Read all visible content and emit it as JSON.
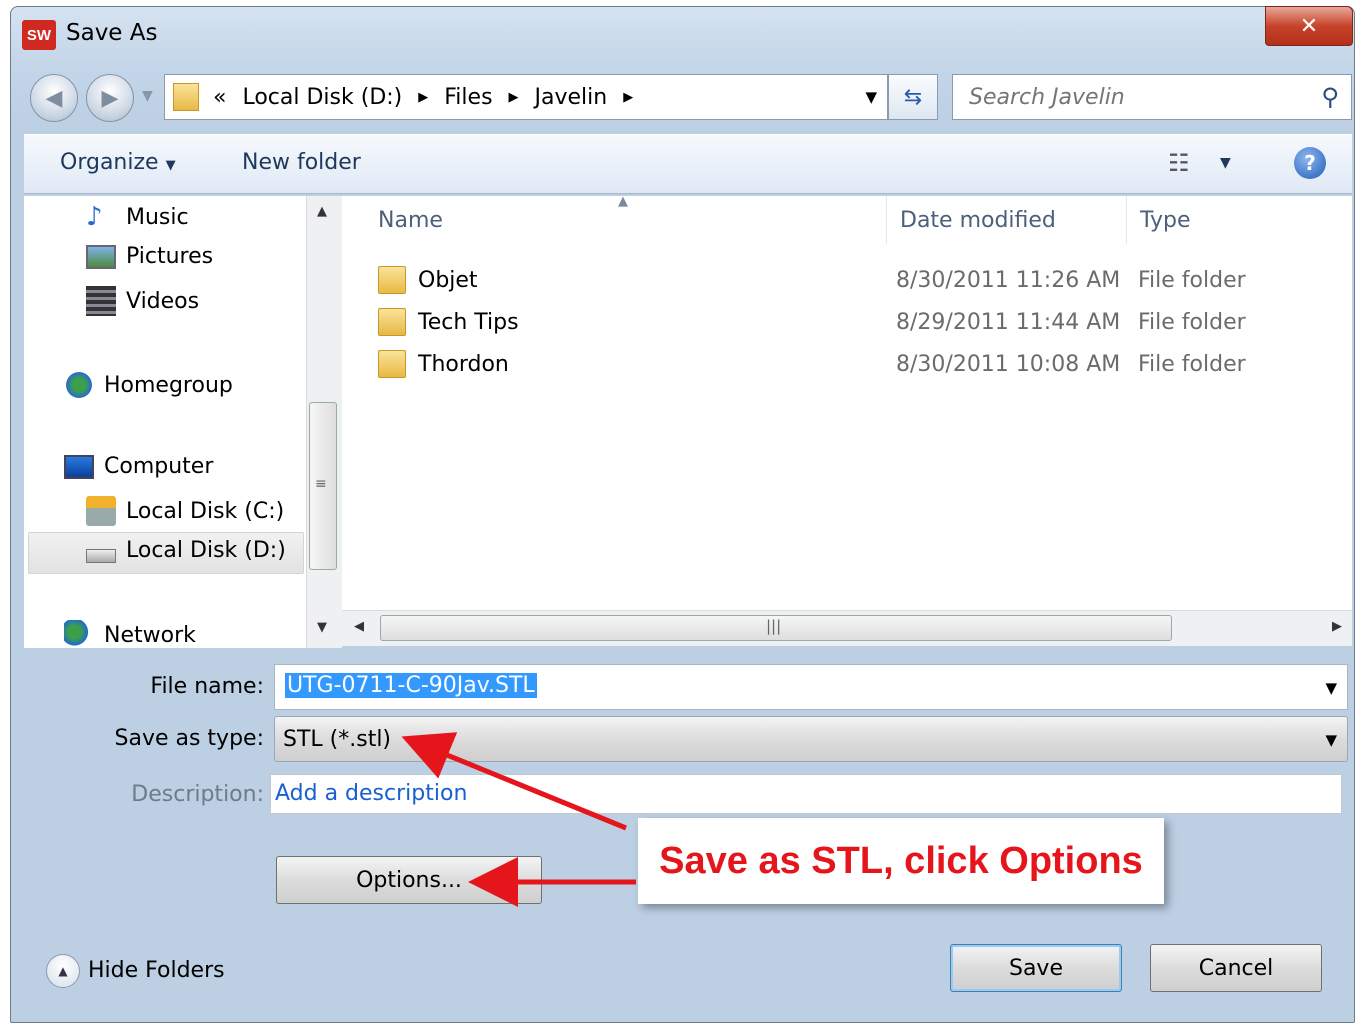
{
  "window": {
    "title": "Save As",
    "app_icon_text": "SW",
    "close_glyph": "✕"
  },
  "address_bar": {
    "overflow_glyph": "«",
    "crumbs": [
      "Local Disk (D:)",
      "Files",
      "Javelin"
    ],
    "separator_glyph": "▶",
    "dropdown_glyph": "▼"
  },
  "search": {
    "placeholder": "Search Javelin"
  },
  "toolbar": {
    "organize_label": "Organize",
    "new_folder_label": "New folder",
    "help_glyph": "?"
  },
  "nav_pane": {
    "items": [
      {
        "label": "Music",
        "icon": "music-icon"
      },
      {
        "label": "Pictures",
        "icon": "pictures-icon"
      },
      {
        "label": "Videos",
        "icon": "videos-icon"
      },
      {
        "label": "Homegroup",
        "icon": "homegroup-icon"
      },
      {
        "label": "Computer",
        "icon": "computer-icon"
      },
      {
        "label": "Local Disk (C:)",
        "icon": "drive-c-icon"
      },
      {
        "label": "Local Disk (D:)",
        "icon": "drive-d-icon",
        "selected": true
      },
      {
        "label": "Network",
        "icon": "network-icon"
      }
    ]
  },
  "file_list": {
    "columns": [
      "Name",
      "Date modified",
      "Type"
    ],
    "rows": [
      {
        "name": "Objet",
        "date": "8/30/2011 11:26 AM",
        "type": "File folder"
      },
      {
        "name": "Tech Tips",
        "date": "8/29/2011 11:44 AM",
        "type": "File folder"
      },
      {
        "name": "Thordon",
        "date": "8/30/2011 10:08 AM",
        "type": "File folder"
      }
    ]
  },
  "form": {
    "file_name_label": "File name:",
    "file_name_value": "UTG-0711-C-90Jav.STL",
    "save_type_label": "Save as type:",
    "save_type_value": "STL (*.stl)",
    "description_label": "Description:",
    "description_link": "Add a description",
    "options_label": "Options..."
  },
  "footer": {
    "hide_folders_label": "Hide Folders",
    "save_label": "Save",
    "cancel_label": "Cancel"
  },
  "annotation": {
    "text": "Save as STL, click Options",
    "color": "#e4161b"
  }
}
